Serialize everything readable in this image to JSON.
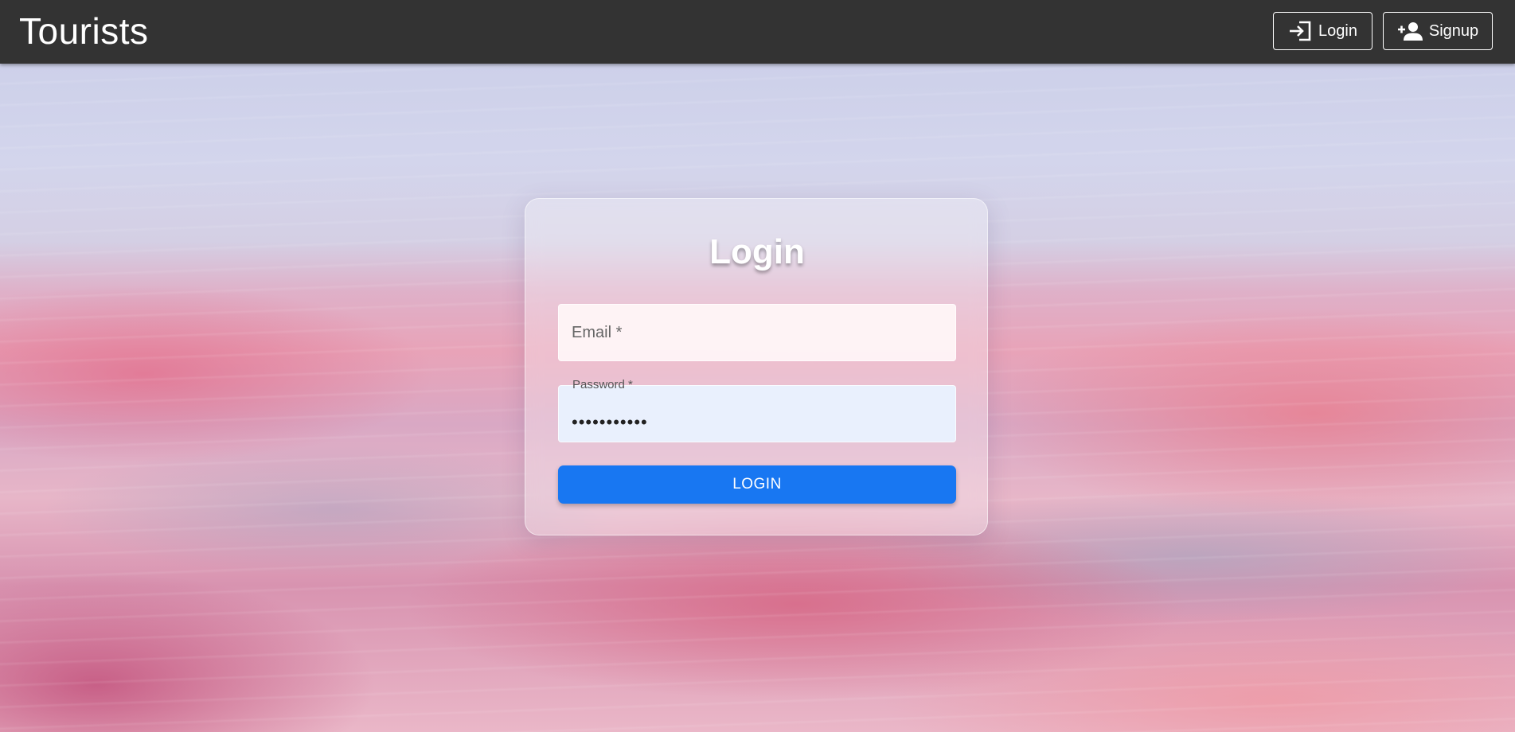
{
  "header": {
    "brand": "Tourists",
    "nav": {
      "login_label": "Login",
      "login_icon": "login-icon",
      "signup_label": "Signup",
      "signup_icon": "person-add-icon"
    },
    "background_color": "#333333"
  },
  "login_form": {
    "title": "Login",
    "email": {
      "placeholder": "Email *",
      "value": ""
    },
    "password": {
      "label": "Password *",
      "value": "•••••••••••"
    },
    "submit_label": "LOGIN",
    "submit_color": "#1877f2"
  }
}
